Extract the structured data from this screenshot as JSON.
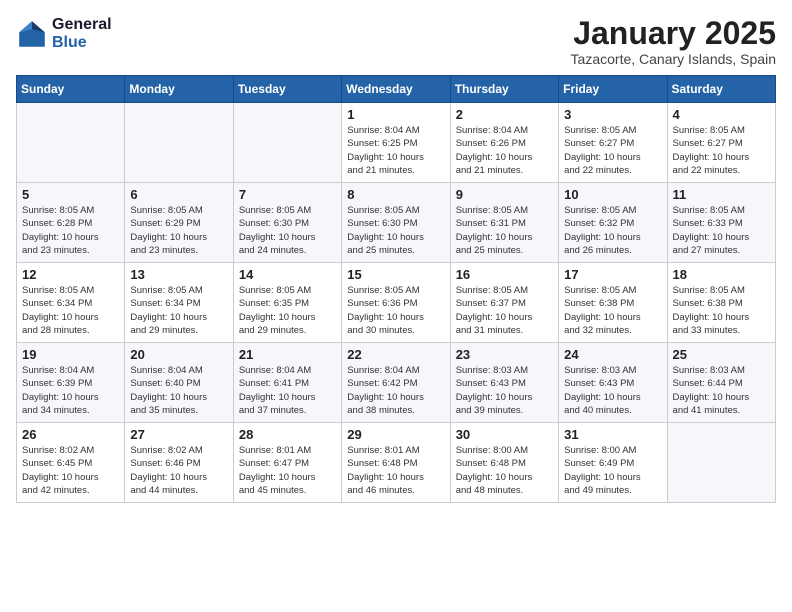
{
  "header": {
    "logo_line1": "General",
    "logo_line2": "Blue",
    "month_title": "January 2025",
    "subtitle": "Tazacorte, Canary Islands, Spain"
  },
  "days_of_week": [
    "Sunday",
    "Monday",
    "Tuesday",
    "Wednesday",
    "Thursday",
    "Friday",
    "Saturday"
  ],
  "weeks": [
    [
      {
        "day": "",
        "content": ""
      },
      {
        "day": "",
        "content": ""
      },
      {
        "day": "",
        "content": ""
      },
      {
        "day": "1",
        "content": "Sunrise: 8:04 AM\nSunset: 6:25 PM\nDaylight: 10 hours\nand 21 minutes."
      },
      {
        "day": "2",
        "content": "Sunrise: 8:04 AM\nSunset: 6:26 PM\nDaylight: 10 hours\nand 21 minutes."
      },
      {
        "day": "3",
        "content": "Sunrise: 8:05 AM\nSunset: 6:27 PM\nDaylight: 10 hours\nand 22 minutes."
      },
      {
        "day": "4",
        "content": "Sunrise: 8:05 AM\nSunset: 6:27 PM\nDaylight: 10 hours\nand 22 minutes."
      }
    ],
    [
      {
        "day": "5",
        "content": "Sunrise: 8:05 AM\nSunset: 6:28 PM\nDaylight: 10 hours\nand 23 minutes."
      },
      {
        "day": "6",
        "content": "Sunrise: 8:05 AM\nSunset: 6:29 PM\nDaylight: 10 hours\nand 23 minutes."
      },
      {
        "day": "7",
        "content": "Sunrise: 8:05 AM\nSunset: 6:30 PM\nDaylight: 10 hours\nand 24 minutes."
      },
      {
        "day": "8",
        "content": "Sunrise: 8:05 AM\nSunset: 6:30 PM\nDaylight: 10 hours\nand 25 minutes."
      },
      {
        "day": "9",
        "content": "Sunrise: 8:05 AM\nSunset: 6:31 PM\nDaylight: 10 hours\nand 25 minutes."
      },
      {
        "day": "10",
        "content": "Sunrise: 8:05 AM\nSunset: 6:32 PM\nDaylight: 10 hours\nand 26 minutes."
      },
      {
        "day": "11",
        "content": "Sunrise: 8:05 AM\nSunset: 6:33 PM\nDaylight: 10 hours\nand 27 minutes."
      }
    ],
    [
      {
        "day": "12",
        "content": "Sunrise: 8:05 AM\nSunset: 6:34 PM\nDaylight: 10 hours\nand 28 minutes."
      },
      {
        "day": "13",
        "content": "Sunrise: 8:05 AM\nSunset: 6:34 PM\nDaylight: 10 hours\nand 29 minutes."
      },
      {
        "day": "14",
        "content": "Sunrise: 8:05 AM\nSunset: 6:35 PM\nDaylight: 10 hours\nand 29 minutes."
      },
      {
        "day": "15",
        "content": "Sunrise: 8:05 AM\nSunset: 6:36 PM\nDaylight: 10 hours\nand 30 minutes."
      },
      {
        "day": "16",
        "content": "Sunrise: 8:05 AM\nSunset: 6:37 PM\nDaylight: 10 hours\nand 31 minutes."
      },
      {
        "day": "17",
        "content": "Sunrise: 8:05 AM\nSunset: 6:38 PM\nDaylight: 10 hours\nand 32 minutes."
      },
      {
        "day": "18",
        "content": "Sunrise: 8:05 AM\nSunset: 6:38 PM\nDaylight: 10 hours\nand 33 minutes."
      }
    ],
    [
      {
        "day": "19",
        "content": "Sunrise: 8:04 AM\nSunset: 6:39 PM\nDaylight: 10 hours\nand 34 minutes."
      },
      {
        "day": "20",
        "content": "Sunrise: 8:04 AM\nSunset: 6:40 PM\nDaylight: 10 hours\nand 35 minutes."
      },
      {
        "day": "21",
        "content": "Sunrise: 8:04 AM\nSunset: 6:41 PM\nDaylight: 10 hours\nand 37 minutes."
      },
      {
        "day": "22",
        "content": "Sunrise: 8:04 AM\nSunset: 6:42 PM\nDaylight: 10 hours\nand 38 minutes."
      },
      {
        "day": "23",
        "content": "Sunrise: 8:03 AM\nSunset: 6:43 PM\nDaylight: 10 hours\nand 39 minutes."
      },
      {
        "day": "24",
        "content": "Sunrise: 8:03 AM\nSunset: 6:43 PM\nDaylight: 10 hours\nand 40 minutes."
      },
      {
        "day": "25",
        "content": "Sunrise: 8:03 AM\nSunset: 6:44 PM\nDaylight: 10 hours\nand 41 minutes."
      }
    ],
    [
      {
        "day": "26",
        "content": "Sunrise: 8:02 AM\nSunset: 6:45 PM\nDaylight: 10 hours\nand 42 minutes."
      },
      {
        "day": "27",
        "content": "Sunrise: 8:02 AM\nSunset: 6:46 PM\nDaylight: 10 hours\nand 44 minutes."
      },
      {
        "day": "28",
        "content": "Sunrise: 8:01 AM\nSunset: 6:47 PM\nDaylight: 10 hours\nand 45 minutes."
      },
      {
        "day": "29",
        "content": "Sunrise: 8:01 AM\nSunset: 6:48 PM\nDaylight: 10 hours\nand 46 minutes."
      },
      {
        "day": "30",
        "content": "Sunrise: 8:00 AM\nSunset: 6:48 PM\nDaylight: 10 hours\nand 48 minutes."
      },
      {
        "day": "31",
        "content": "Sunrise: 8:00 AM\nSunset: 6:49 PM\nDaylight: 10 hours\nand 49 minutes."
      },
      {
        "day": "",
        "content": ""
      }
    ]
  ]
}
